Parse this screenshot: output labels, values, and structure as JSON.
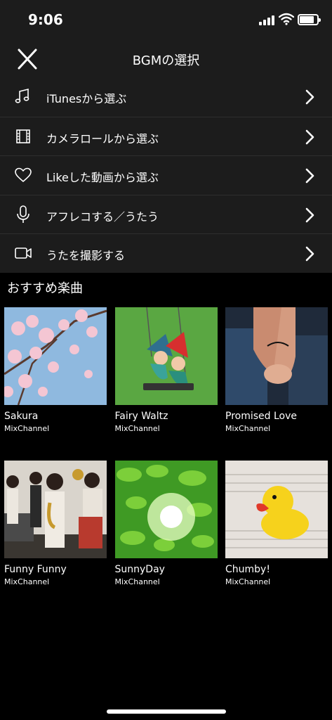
{
  "status": {
    "time": "9:06"
  },
  "header": {
    "title": "BGMの選択"
  },
  "menu": {
    "items": [
      {
        "label": "iTunesから選ぶ",
        "icon": "music-note-icon"
      },
      {
        "label": "カメラロールから選ぶ",
        "icon": "film-icon"
      },
      {
        "label": "Likeした動画から選ぶ",
        "icon": "heart-icon"
      },
      {
        "label": "アフレコする／うたう",
        "icon": "microphone-icon"
      },
      {
        "label": "うたを撮影する",
        "icon": "video-camera-icon"
      }
    ]
  },
  "recommended": {
    "title": "おすすめ楽曲",
    "songs": [
      {
        "title": "Sakura",
        "artist": "MixChannel"
      },
      {
        "title": "Fairy Waltz",
        "artist": "MixChannel"
      },
      {
        "title": "Promised Love",
        "artist": "MixChannel"
      },
      {
        "title": "Funny Funny",
        "artist": "MixChannel"
      },
      {
        "title": "SunnyDay",
        "artist": "MixChannel"
      },
      {
        "title": "Chumby!",
        "artist": "MixChannel"
      }
    ]
  },
  "colors": {
    "background": "#000000",
    "bar": "#1c1c1c",
    "divider": "#2e2e2e",
    "text": "#ffffff"
  }
}
